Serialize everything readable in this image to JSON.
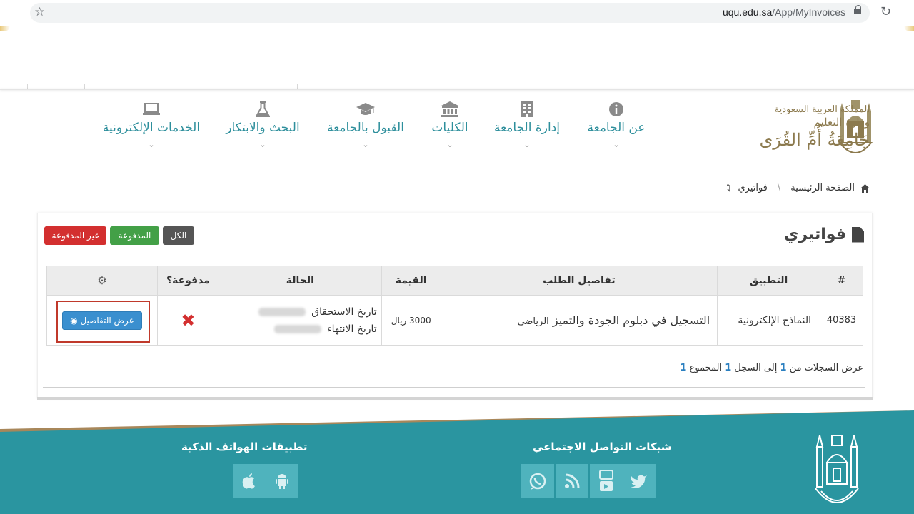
{
  "browser": {
    "url_host": "uqu.edu.sa",
    "url_path": "/App/MyInvoices"
  },
  "logo": {
    "line1": "المملكة العربية السعودية",
    "line2": "وزارة التعليم",
    "line3": "جَامِعَةُ أُمِّ القُرَى"
  },
  "nav": {
    "items": [
      {
        "label": "عن الجامعة",
        "icon": "info-icon"
      },
      {
        "label": "إدارة الجامعة",
        "icon": "building-icon"
      },
      {
        "label": "الكليات",
        "icon": "institution-icon"
      },
      {
        "label": "القبول بالجامعة",
        "icon": "graduation-cap-icon"
      },
      {
        "label": "البحث والابتكار",
        "icon": "flask-icon"
      },
      {
        "label": "الخدمات الإلكترونية",
        "icon": "laptop-icon"
      }
    ],
    "chevron": "⌄"
  },
  "breadcrumb": {
    "home": "الصفحة الرئيسية",
    "separator": "\\",
    "current": "فواتيري"
  },
  "page": {
    "title": "فواتيري"
  },
  "filters": {
    "all": "الكل",
    "paid": "المدفوعة",
    "unpaid": "غير المدفوعة"
  },
  "table": {
    "headers": [
      "#",
      "التطبيق",
      "تفاصيل الطلب",
      "القيمة",
      "الحالة",
      "مدفوعة؟"
    ],
    "rows": [
      {
        "id": "40383",
        "app": "النماذج الإلكترونية",
        "details_main": "التسجيل في دبلوم الجودة والتميز",
        "details_small": "الرياضي",
        "value": "3000 ريال",
        "due_label": "تاريخ الاستحقاق",
        "end_label": "تاريخ الانتهاء",
        "paid_mark": "✖",
        "action_label": "عرض التفاصيل"
      }
    ]
  },
  "records": {
    "from_label": "عرض السجلات من",
    "from": "1",
    "to_label": "إلى السجل",
    "to": "1",
    "total_label": "المجموع",
    "total": "1"
  },
  "footer": {
    "social_title": "شبكات التواصل الاجتماعي",
    "apps_title": "تطبيقات الهواتف الذكية"
  },
  "colors": {
    "teal": "#2a95a0",
    "gold": "#a8875a",
    "nav_text": "#2e8f9c",
    "paid_green": "#43a047",
    "unpaid_red": "#d32f2f",
    "details_blue": "#3a8fcf"
  }
}
